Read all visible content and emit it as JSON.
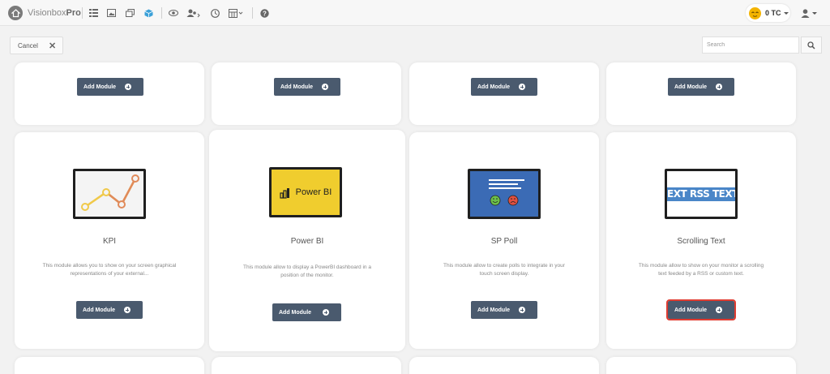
{
  "app": {
    "brand_light": "Visionbox",
    "brand_bold": "Pro"
  },
  "topbar": {
    "icons": [
      "list-icon",
      "image-icon",
      "layers-icon",
      "cube-icon",
      "eye-icon",
      "users-icon",
      "clock-icon",
      "grid-icon",
      "help-icon"
    ],
    "credits": "0 TC"
  },
  "actions": {
    "cancel_label": "Cancel",
    "search_placeholder": "Search"
  },
  "modules": {
    "top_row_button": "Add Module",
    "items": [
      {
        "title": "KPI",
        "description": "This module allows you to show on your screen graphical representations of your external...",
        "button": "Add Module"
      },
      {
        "title": "Power BI",
        "description": "This module allow to display a PowerBI dashboard in a position of the monitor.",
        "button": "Add Module",
        "logo_text": "Power BI"
      },
      {
        "title": "SP Poll",
        "description": "This module allow to create polls to integrate in your touch screen display.",
        "button": "Add Module"
      },
      {
        "title": "Scrolling Text",
        "description": "This module allow to show on your monitor a scrolling text feeded by a RSS or custom text.",
        "button": "Add Module",
        "ticker_text": "EXT RSS TEXT"
      }
    ]
  },
  "colors": {
    "button": "#4a5a6e",
    "powerbi_bg": "#f0cd2e",
    "poll_bg": "#3b6bb5",
    "rss_bg": "#4a86c8",
    "highlight": "#e03c31"
  }
}
